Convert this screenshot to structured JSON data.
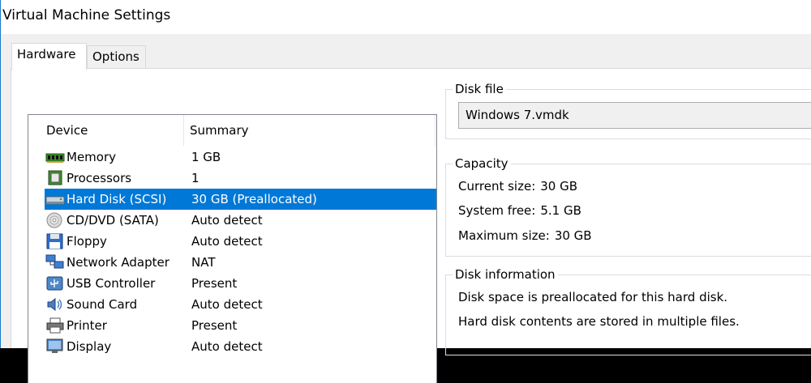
{
  "window": {
    "title": "Virtual Machine Settings"
  },
  "tabs": [
    {
      "label": "Hardware",
      "active": true
    },
    {
      "label": "Options",
      "active": false
    }
  ],
  "device_list": {
    "columns": [
      "Device",
      "Summary"
    ],
    "rows": [
      {
        "device": "Memory",
        "summary": "1 GB",
        "icon": "memory-icon",
        "selected": false
      },
      {
        "device": "Processors",
        "summary": "1",
        "icon": "processor-icon",
        "selected": false
      },
      {
        "device": "Hard Disk (SCSI)",
        "summary": "30 GB (Preallocated)",
        "icon": "hard-disk-icon",
        "selected": true
      },
      {
        "device": "CD/DVD (SATA)",
        "summary": "Auto detect",
        "icon": "cd-dvd-icon",
        "selected": false
      },
      {
        "device": "Floppy",
        "summary": "Auto detect",
        "icon": "floppy-icon",
        "selected": false
      },
      {
        "device": "Network Adapter",
        "summary": "NAT",
        "icon": "network-adapter-icon",
        "selected": false
      },
      {
        "device": "USB Controller",
        "summary": "Present",
        "icon": "usb-icon",
        "selected": false
      },
      {
        "device": "Sound Card",
        "summary": "Auto detect",
        "icon": "sound-card-icon",
        "selected": false
      },
      {
        "device": "Printer",
        "summary": "Present",
        "icon": "printer-icon",
        "selected": false
      },
      {
        "device": "Display",
        "summary": "Auto detect",
        "icon": "display-icon",
        "selected": false
      }
    ]
  },
  "disk_file": {
    "label": "Disk file",
    "value": "Windows 7.vmdk"
  },
  "capacity": {
    "label": "Capacity",
    "items": [
      {
        "key": "Current size:",
        "value": "30 GB"
      },
      {
        "key": "System free:",
        "value": "5.1 GB"
      },
      {
        "key": "Maximum size:",
        "value": "30 GB"
      }
    ]
  },
  "disk_information": {
    "label": "Disk information",
    "lines": [
      "Disk space is preallocated for this hard disk.",
      "Hard disk contents are stored in multiple files."
    ]
  },
  "colors": {
    "selection": "#0078d7",
    "window_border": "#1979ca"
  }
}
